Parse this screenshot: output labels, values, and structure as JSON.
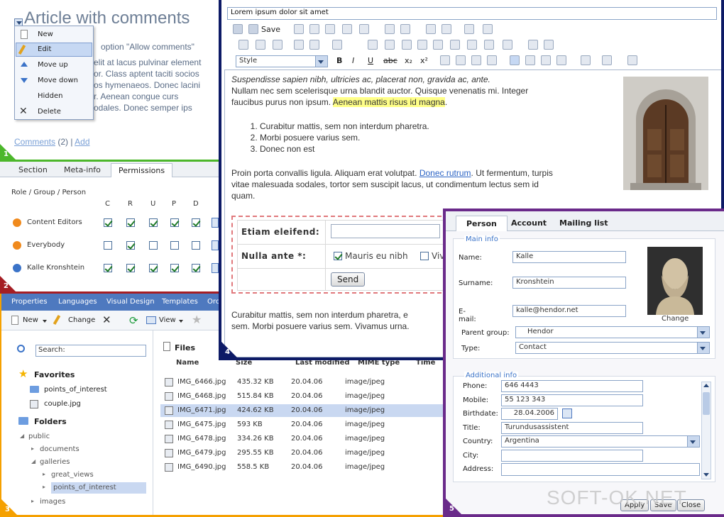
{
  "panel1": {
    "title": "Article with comments",
    "body_line1": "option \"Allow comments\"",
    "body_line2": "elit at lacus pulvinar element",
    "body_line3": "or. Class aptent taciti socios",
    "body_line4": "os hymenaeos. Donec lacini",
    "body_line5": "r. Aenean congue curs",
    "body_line6": "odales. Donec semper ips",
    "comments_label": "Comments",
    "comments_count": "(2)",
    "separator": "|",
    "add_label": "Add",
    "menu": [
      "New",
      "Edit",
      "Move up",
      "Move down",
      "Hidden",
      "Delete"
    ],
    "number": "1"
  },
  "panel2": {
    "tabs": [
      "Section",
      "Meta-info",
      "Permissions"
    ],
    "header": "Role / Group / Person",
    "columns": [
      "C",
      "R",
      "U",
      "P",
      "D"
    ],
    "rows": [
      {
        "name": "Content Editors",
        "checks": [
          true,
          true,
          true,
          true,
          true
        ]
      },
      {
        "name": "Everybody",
        "checks": [
          false,
          true,
          false,
          false,
          false
        ]
      },
      {
        "name": "Kalle Kronshtein",
        "checks": [
          true,
          true,
          true,
          true,
          true
        ]
      }
    ],
    "number": "2"
  },
  "panel3": {
    "tabs": [
      "Properties",
      "Languages",
      "Visual Design",
      "Templates",
      "Orc"
    ],
    "toolbar": {
      "new": "New",
      "change": "Change",
      "view": "View"
    },
    "search_placeholder": "Search:",
    "favorites_label": "Favorites",
    "favorites": [
      "points_of_interest",
      "couple.jpg"
    ],
    "folders_label": "Folders",
    "folders": [
      "public",
      "documents",
      "galleries",
      "great_views",
      "points_of_interest",
      "images"
    ],
    "files_label": "Files",
    "columns": [
      "Name",
      "Size",
      "Last modified",
      "MIME type",
      "Time"
    ],
    "files": [
      {
        "name": "IMG_6466.jpg",
        "size": "435.32 KB",
        "date": "20.04.06",
        "mime": "image/jpeg"
      },
      {
        "name": "IMG_6468.jpg",
        "size": "515.84 KB",
        "date": "20.04.06",
        "mime": "image/jpeg"
      },
      {
        "name": "IMG_6471.jpg",
        "size": "424.62 KB",
        "date": "20.04.06",
        "mime": "image/jpeg"
      },
      {
        "name": "IMG_6475.jpg",
        "size": "593 KB",
        "date": "20.04.06",
        "mime": "image/jpeg"
      },
      {
        "name": "IMG_6478.jpg",
        "size": "334.26 KB",
        "date": "20.04.06",
        "mime": "image/jpeg"
      },
      {
        "name": "IMG_6479.jpg",
        "size": "295.55 KB",
        "date": "20.04.06",
        "mime": "image/jpeg"
      },
      {
        "name": "IMG_6490.jpg",
        "size": "558.5 KB",
        "date": "20.04.06",
        "mime": "image/jpeg"
      }
    ],
    "number": "3"
  },
  "panel4": {
    "title_value": "Lorem ipsum dolor sit amet",
    "save_label": "Save",
    "style_label": "Style",
    "italic_line": "Suspendisse sapien nibh, ultricies ac, placerat non, gravida ac, ante.",
    "para1a": "Nullam nec sem scelerisque urna blandit auctor. Quisque venenatis mi. Integer",
    "para1b": "faucibus purus non ipsum.",
    "highlight": "Aenean mattis risus id magna",
    "para1c": ".",
    "list": [
      "Curabitur mattis, sem non interdum pharetra.",
      "Morbi posuere varius sem.",
      "Donec non est"
    ],
    "para2a": "Proin porta convallis ligula. Aliquam erat volutpat.",
    "para2_link": "Donec rutrum",
    "para2b": ". Ut fermentum, turpis",
    "para2c": "vitae malesuada sodales, tortor sem suscipit lacus, ut condimentum lectus sem id",
    "para2d": "quam.",
    "form_label1": "Etiam eleifend:",
    "form_label2": "Nulla ante *:",
    "check1": "Mauris eu nibh",
    "check2": "Viv",
    "send": "Send",
    "para3a": "Curabitur mattis, sem non interdum pharetra, e",
    "para3b": "sem. Morbi posuere varius sem. Vivamus urna.",
    "number": "4"
  },
  "panel5": {
    "tabs": [
      "Person",
      "Account",
      "Mailing list"
    ],
    "main_info": "Main info",
    "fields": [
      {
        "label": "Name:",
        "value": "Kalle"
      },
      {
        "label": "Surname:",
        "value": "Kronshtein"
      },
      {
        "label": "E-mail:",
        "value": "kalle@hendor.net"
      }
    ],
    "change": "Change",
    "parent_group_label": "Parent group:",
    "parent_group_value": "Hendor",
    "type_label": "Type:",
    "type_value": "Contact",
    "additional_info": "Additional info",
    "add_fields": [
      {
        "label": "Phone:",
        "value": "646 4443"
      },
      {
        "label": "Mobile:",
        "value": "55 123 343"
      },
      {
        "label": "Birthdate:",
        "value": "28.04.2006"
      },
      {
        "label": "Title:",
        "value": "Turundusassistent"
      },
      {
        "label": "Country:",
        "value": "Argentina"
      },
      {
        "label": "City:",
        "value": ""
      },
      {
        "label": "Address:",
        "value": ""
      }
    ],
    "buttons": [
      "Apply",
      "Save",
      "Close"
    ],
    "number": "5"
  },
  "watermark": "SOFT-OK.NET",
  "colors": {
    "p1": "#4cb72b",
    "p2": "#a51e24",
    "p3": "#f5a000",
    "p4": "#0d1a66",
    "p5": "#6a2a8a"
  }
}
